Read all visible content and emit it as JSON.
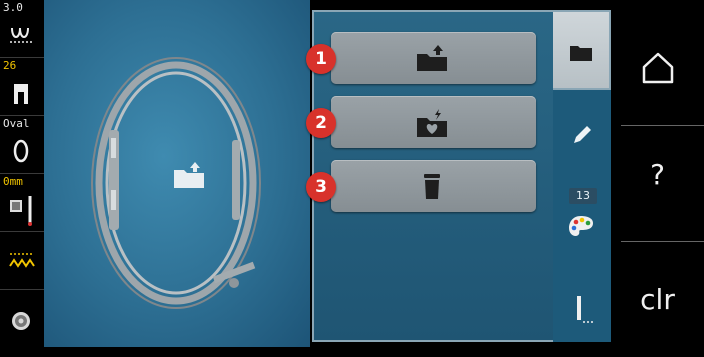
{
  "left_bar": {
    "stitch_width": "3.0",
    "presser_foot": "26",
    "hoop": "Oval",
    "offset": "0mm"
  },
  "panel": {
    "buttons": [
      {
        "badge": "1",
        "icon": "folder-upload-icon"
      },
      {
        "badge": "2",
        "icon": "folder-heart-icon"
      },
      {
        "badge": "3",
        "icon": "trash-icon"
      }
    ]
  },
  "tabs": {
    "items": [
      {
        "icon": "folder-icon"
      },
      {
        "icon": "pencil-icon"
      },
      {
        "icon": "palette-icon",
        "count": "13"
      },
      {
        "icon": "needle-stitch-icon"
      }
    ]
  },
  "right_nav": {
    "home_icon": "home-icon",
    "help_label": "?",
    "clear_label": "clr"
  },
  "colors": {
    "badge": "#d8322b",
    "panel": "#2a6786",
    "accent_yellow": "#f2c500"
  }
}
